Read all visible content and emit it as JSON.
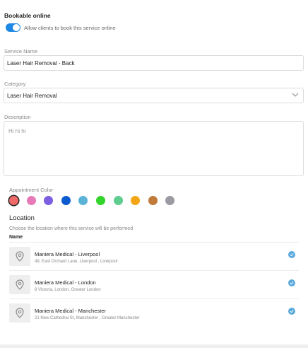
{
  "bookable": {
    "title": "Bookable online",
    "toggle_label": "Allow clients to book this service online"
  },
  "service_name": {
    "label": "Service Name",
    "value": "Laser Hair Removal - Back"
  },
  "category": {
    "label": "Category",
    "value": "Laser Hair Removal"
  },
  "description": {
    "label": "Description",
    "value": "Hi hi hi"
  },
  "appointment_color": {
    "label": "Appointment Color",
    "colors": [
      "#f06a6a",
      "#e879b8",
      "#7b5fe0",
      "#0c5bd0",
      "#5bb4d8",
      "#33d42b",
      "#5ecd8f",
      "#f2a616",
      "#c07a3a",
      "#9a9aa2"
    ],
    "selected_index": 0
  },
  "location": {
    "title": "Location",
    "subtitle": "Choose the location where this service will be performed",
    "name_header": "Name",
    "items": [
      {
        "name": "Maniera Medical - Liverpool",
        "address": "49, East Orchard Lane, Liverpool , Liverpool",
        "checked": true
      },
      {
        "name": "Maniera Medical - London",
        "address": "8 Victoria, London, Greater London",
        "checked": true
      },
      {
        "name": "Maniera Medical - Manchester",
        "address": "21 New Cathedral St, Manchester , Greater Manchester",
        "checked": true
      }
    ]
  },
  "icons": {
    "location": "map-pin-icon",
    "check": "check-circle-icon",
    "dropdown": "chevron-down-icon"
  }
}
